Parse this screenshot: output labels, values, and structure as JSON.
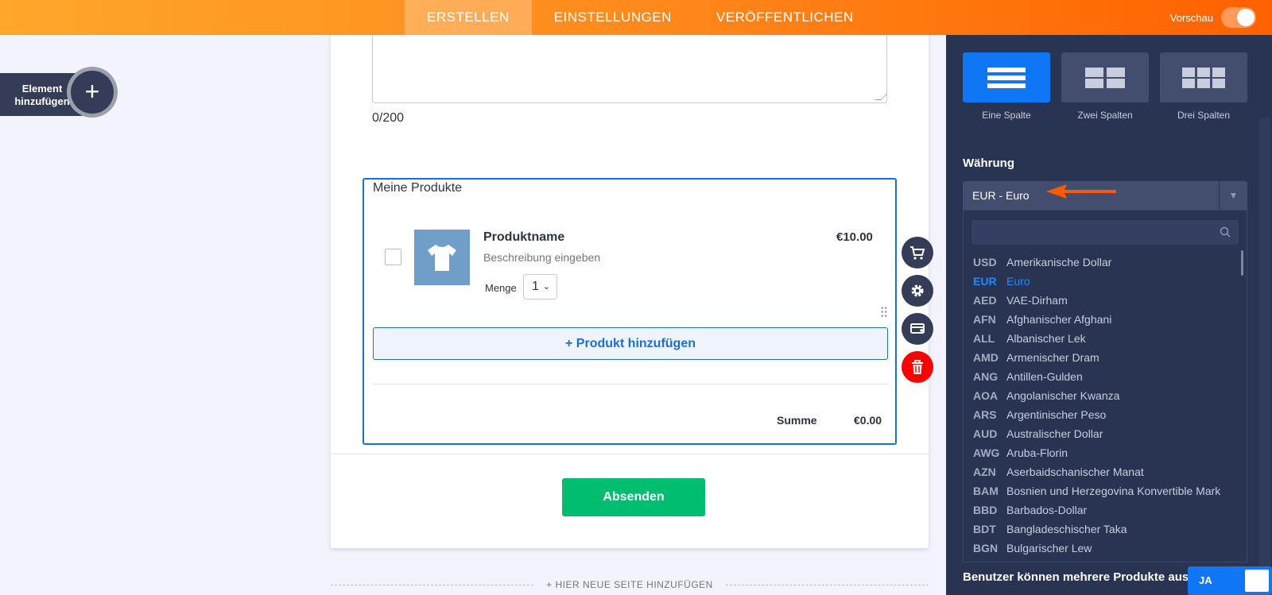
{
  "topbar": {
    "tabs": [
      {
        "label": "ERSTELLEN",
        "active": true
      },
      {
        "label": "EINSTELLUNGEN",
        "active": false
      },
      {
        "label": "VERÖFFENTLICHEN",
        "active": false
      }
    ],
    "preview_label": "Vorschau"
  },
  "add_element": {
    "label_line1": "Element",
    "label_line2": "hinzufügen",
    "icon": "plus-icon"
  },
  "form": {
    "char_count": "0/200",
    "products": {
      "title": "Meine Produkte",
      "item": {
        "name": "Produktname",
        "description": "Beschreibung eingeben",
        "quantity_label": "Menge",
        "quantity": "1",
        "price": "€10.00",
        "image_icon": "tshirt-icon"
      },
      "add_button": "+ Produkt hinzufügen",
      "sum_label": "Summe",
      "sum_value": "€0.00"
    },
    "submit_label": "Absenden",
    "add_page_label": "+ HIER NEUE SEITE HINZUFÜGEN"
  },
  "tools": [
    "cart-icon",
    "gear-icon",
    "payment-add-icon",
    "trash-icon"
  ],
  "panel": {
    "layouts": [
      {
        "label": "Eine Spalte",
        "active": true
      },
      {
        "label": "Zwei Spalten",
        "active": false
      },
      {
        "label": "Drei Spalten",
        "active": false
      }
    ],
    "currency_label": "Währung",
    "currency_value": "EUR - Euro",
    "search_value": "",
    "currencies": [
      {
        "code": "USD",
        "name": "Amerikanische Dollar"
      },
      {
        "code": "EUR",
        "name": "Euro",
        "selected": true
      },
      {
        "code": "AED",
        "name": "VAE-Dirham"
      },
      {
        "code": "AFN",
        "name": "Afghanischer Afghani"
      },
      {
        "code": "ALL",
        "name": "Albanischer Lek"
      },
      {
        "code": "AMD",
        "name": "Armenischer Dram"
      },
      {
        "code": "ANG",
        "name": "Antillen-Gulden"
      },
      {
        "code": "AOA",
        "name": "Angolanischer Kwanza"
      },
      {
        "code": "ARS",
        "name": "Argentinischer Peso"
      },
      {
        "code": "AUD",
        "name": "Australischer Dollar"
      },
      {
        "code": "AWG",
        "name": "Aruba-Florin"
      },
      {
        "code": "AZN",
        "name": "Aserbaidschanischer Manat"
      },
      {
        "code": "BAM",
        "name": "Bosnien und Herzegovina Konvertible Mark"
      },
      {
        "code": "BBD",
        "name": "Barbados-Dollar"
      },
      {
        "code": "BDT",
        "name": "Bangladeschischer Taka"
      },
      {
        "code": "BGN",
        "name": "Bulgarischer Lew"
      }
    ],
    "multi_select_label": "Benutzer können mehrere Produkte auswählen",
    "multi_select_value": "JA"
  },
  "colors": {
    "accent_orange": "#ff6100",
    "brand_blue": "#0f77f5",
    "submit_green": "#01bd6f",
    "delete_red": "#ff0000"
  }
}
